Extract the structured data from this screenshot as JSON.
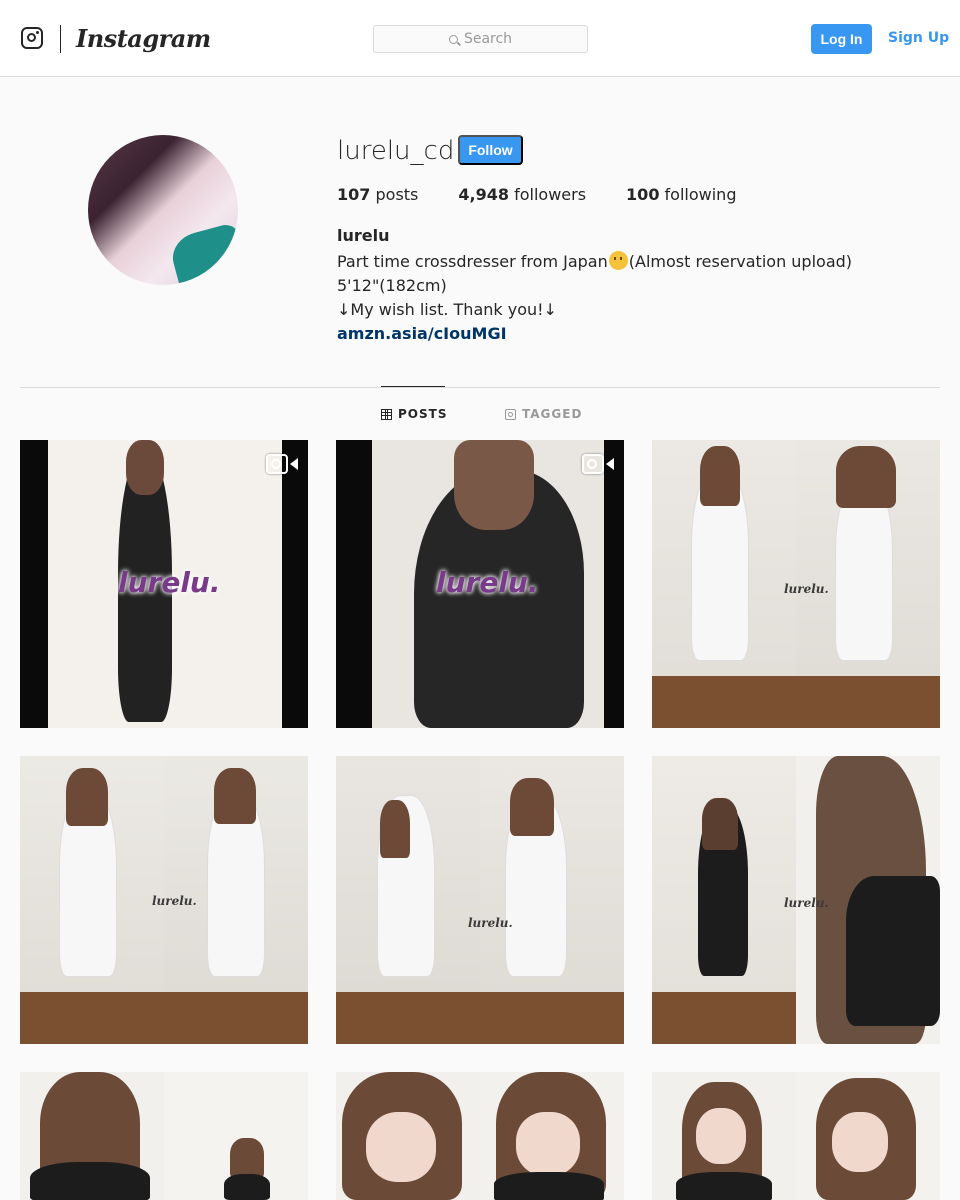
{
  "header": {
    "brand": "Instagram",
    "search_placeholder": "Search",
    "login_label": "Log In",
    "signup_label": "Sign Up"
  },
  "profile": {
    "username": "lurelu_cd",
    "follow_label": "Follow",
    "stats": {
      "posts_count": "107",
      "posts_label": "posts",
      "followers_count": "4,948",
      "followers_label": "followers",
      "following_count": "100",
      "following_label": "following"
    },
    "full_name": "lurelu",
    "bio_line1_before": "Part time crossdresser from Japan",
    "bio_line1_after": "(Almost reservation upload)",
    "bio_line2": "5'12\"(182cm)",
    "bio_line3": "↓My wish list. Thank you!↓",
    "bio_link": "amzn.asia/cIouMGI"
  },
  "tabs": {
    "posts_label": "POSTS",
    "tagged_label": "TAGGED"
  },
  "posts": {
    "watermark_large": "lurelu.",
    "watermark_small": "lurelu."
  },
  "colors": {
    "accent": "#3897f0",
    "link": "#003569",
    "border": "#dbdbdb",
    "background": "#fafafa"
  }
}
